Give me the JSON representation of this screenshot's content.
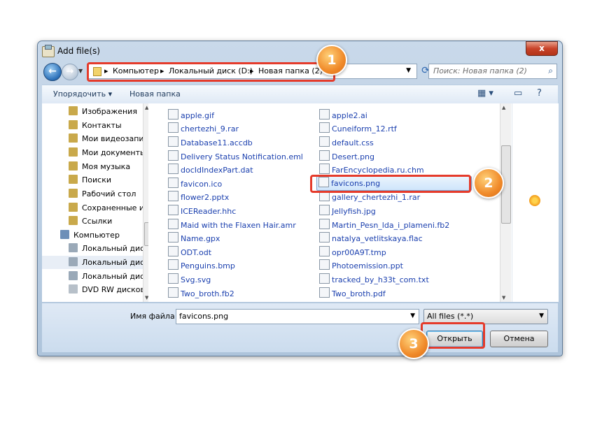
{
  "window": {
    "title": "Add file(s)",
    "close_label": "x"
  },
  "nav": {
    "back_label": "←",
    "forward_label": "→",
    "breadcrumbs": [
      "Компьютер",
      "Локальный диск (D:)",
      "Новая папка (2)"
    ],
    "search_placeholder": "Поиск: Новая папка (2)"
  },
  "toolbar": {
    "organize": "Упорядочить ▾",
    "new_folder": "Новая папка"
  },
  "tree": [
    {
      "label": "Изображения",
      "icon": "images-library-icon"
    },
    {
      "label": "Контакты",
      "icon": "contacts-icon"
    },
    {
      "label": "Мои видеозаписи",
      "icon": "videos-icon"
    },
    {
      "label": "Мои документы",
      "icon": "documents-icon"
    },
    {
      "label": "Моя музыка",
      "icon": "music-icon"
    },
    {
      "label": "Поиски",
      "icon": "searches-icon"
    },
    {
      "label": "Рабочий стол",
      "icon": "desktop-icon"
    },
    {
      "label": "Сохраненные игр",
      "icon": "saved-games-icon"
    },
    {
      "label": "Ссылки",
      "icon": "links-icon"
    },
    {
      "label": "Компьютер",
      "icon": "computer-icon"
    },
    {
      "label": "Локальный диск",
      "icon": "system-drive-icon"
    },
    {
      "label": "Локальный диск",
      "icon": "drive-icon"
    },
    {
      "label": "Локальный диск",
      "icon": "drive-icon"
    },
    {
      "label": "DVD RW дисково",
      "icon": "dvd-drive-icon"
    }
  ],
  "files_left": [
    {
      "name": "apple.gif",
      "icon": "gif-file-icon"
    },
    {
      "name": "chertezhi_9.rar",
      "icon": "rar-file-icon"
    },
    {
      "name": "Database11.accdb",
      "icon": "file-icon"
    },
    {
      "name": "Delivery Status Notification.eml",
      "icon": "file-icon"
    },
    {
      "name": "docIdIndexPart.dat",
      "icon": "dat-file-icon"
    },
    {
      "name": "favicon.ico",
      "icon": "ico-file-icon"
    },
    {
      "name": "flower2.pptx",
      "icon": "pptx-file-icon"
    },
    {
      "name": "ICEReader.hhc",
      "icon": "file-icon"
    },
    {
      "name": "Maid with the Flaxen Hair.amr",
      "icon": "amr-file-icon"
    },
    {
      "name": "Name.gpx",
      "icon": "file-icon"
    },
    {
      "name": "ODT.odt",
      "icon": "odt-file-icon"
    },
    {
      "name": "Penguins.bmp",
      "icon": "bmp-file-icon"
    },
    {
      "name": "Svg.svg",
      "icon": "svg-file-icon"
    },
    {
      "name": "Two_broth.fb2",
      "icon": "file-icon"
    }
  ],
  "files_right": [
    {
      "name": "apple2.ai",
      "icon": "ai-file-icon"
    },
    {
      "name": "Cuneiform_12.rtf",
      "icon": "rtf-file-icon"
    },
    {
      "name": "default.css",
      "icon": "file-icon"
    },
    {
      "name": "Desert.png",
      "icon": "png-file-icon"
    },
    {
      "name": "FarEncyclopedia.ru.chm",
      "icon": "chm-file-icon"
    },
    {
      "name": "favicons.png",
      "icon": "png-file-icon",
      "selected": true
    },
    {
      "name": "gallery_chertezhi_1.rar",
      "icon": "rar-file-icon"
    },
    {
      "name": "Jellyfish.jpg",
      "icon": "jpg-file-icon"
    },
    {
      "name": "Martin_Pesn_lda_i_plameni.fb2",
      "icon": "file-icon"
    },
    {
      "name": "natalya_vetlitskaya.flac",
      "icon": "flac-file-icon"
    },
    {
      "name": "opr00A9T.tmp",
      "icon": "tmp-file-icon"
    },
    {
      "name": "Photoemission.ppt",
      "icon": "file-icon"
    },
    {
      "name": "tracked_by_h33t_com.txt",
      "icon": "txt-file-icon"
    },
    {
      "name": "Two_broth.pdf",
      "icon": "pdf-file-icon"
    }
  ],
  "bottom": {
    "filename_label": "Имя файла:",
    "filename_value": "favicons.png",
    "filter_value": "All files (*.*)",
    "open_label": "Открыть",
    "cancel_label": "Отмена"
  },
  "callouts": [
    "1",
    "2",
    "3"
  ],
  "colors": {
    "accent_callout": "#f08a2a",
    "highlight_border": "#e53b2b",
    "link_text": "#1a3fae"
  }
}
